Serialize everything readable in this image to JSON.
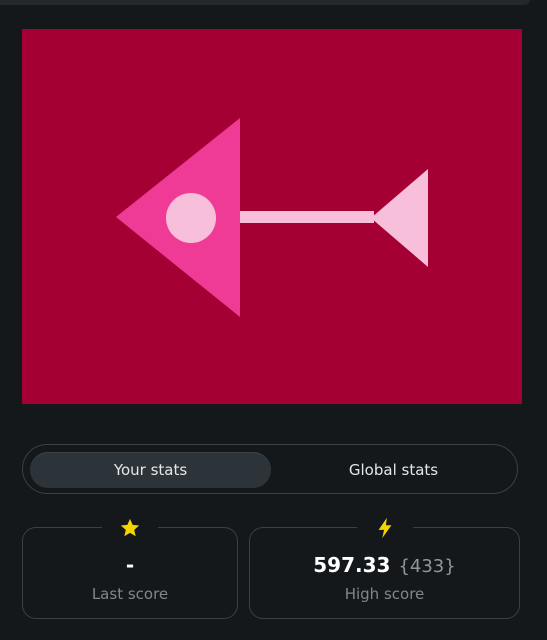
{
  "tabs": {
    "your_stats": "Your stats",
    "global_stats": "Global stats",
    "active": "your_stats"
  },
  "stats": {
    "last_score": {
      "icon": "star-icon",
      "value": "-",
      "label": "Last score"
    },
    "high_score": {
      "icon": "lightning-icon",
      "value": "597.33",
      "extra": "{433}",
      "label": "High score"
    }
  },
  "colors": {
    "background": "#14181b",
    "canvas_bg": "#a50034",
    "triangle_large": "#ef3b96",
    "shape_light": "#f7bfd9",
    "icon_yellow": "#f5d400"
  }
}
